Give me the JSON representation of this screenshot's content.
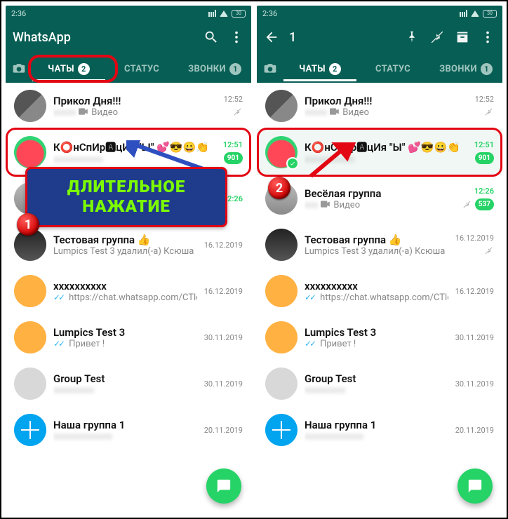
{
  "status": {
    "time": "2:36",
    "battery": "30"
  },
  "left": {
    "title": "WhatsApp",
    "tabs": {
      "chats": "ЧАТЫ",
      "chats_badge": "2",
      "status": "СТАТУС",
      "calls": "ЗВОНКИ",
      "calls_badge": "1"
    },
    "tooltip": "ДЛИТЕЛЬНОЕ\nНАЖАТИЕ",
    "marker": "1"
  },
  "right": {
    "title": "1",
    "tabs": {
      "chats": "ЧАТЫ",
      "chats_badge": "2",
      "status": "СТАТУС",
      "calls": "ЗВОНКИ",
      "calls_badge": "1"
    },
    "marker": "2"
  },
  "chats": [
    {
      "name": "Прикол Дня!!!",
      "sub_icon": "video",
      "sub": "Видео",
      "time": "12:52",
      "muted": true
    },
    {
      "name": "К⭕нСпИр🅰цИя \"Ы\" 💕😎😀👏",
      "sub": "",
      "time": "12:51",
      "badge": "901"
    },
    {
      "name": "Весёлая группа",
      "sub_icon": "video",
      "sub": "Видео",
      "time": "12:26",
      "muted": true,
      "badge_r": "537"
    },
    {
      "name": "Тестовая группа 👍",
      "sub": "Lumpics Test 3 удалил(-а) Ксюша",
      "time": "16.12.2019",
      "muted": true
    },
    {
      "name": "",
      "sub_ticks": true,
      "sub": "https://chat.whatsapp.com/CTlcBFu...",
      "time": "16.12.2019"
    },
    {
      "name": "Lumpics Test 3",
      "sub_ticks": true,
      "sub": "Привет !",
      "time": "30.11.2019"
    },
    {
      "name": "Group Test",
      "sub": "",
      "time": "30.11.2019"
    },
    {
      "name": "Наша группа 1",
      "sub": "",
      "time": "20.11.2019"
    }
  ]
}
